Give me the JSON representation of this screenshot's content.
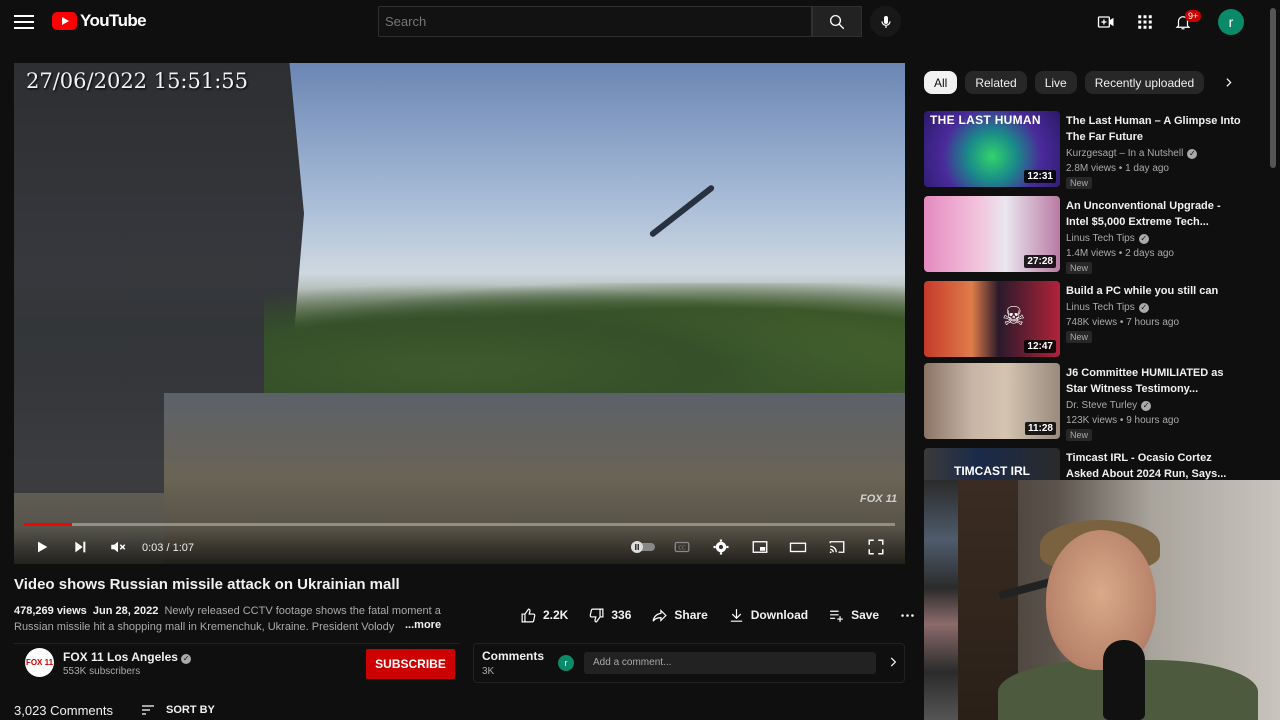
{
  "header": {
    "logo_text": "YouTube",
    "search_placeholder": "Search",
    "notification_badge": "9+",
    "avatar_letter": "r"
  },
  "video": {
    "timestamp_overlay": "27/06/2022 15:51:55",
    "watermark": "FOX 11",
    "current_time": "0:03 / 1:07",
    "progress_fraction": 0.055,
    "title": "Video shows Russian missile attack on Ukrainian mall"
  },
  "description": {
    "views": "478,269 views",
    "date": "Jun 28, 2022",
    "text": "Newly released CCTV footage shows the fatal moment a Russian missile hit a shopping mall in Kremenchuk, Ukraine. President Volody",
    "more_label": "...more"
  },
  "actions": {
    "likes": "2.2K",
    "dislikes": "336",
    "share": "Share",
    "download": "Download",
    "save": "Save"
  },
  "channel": {
    "logo_text": "FOX 11",
    "name": "FOX 11 Los Angeles",
    "subscribers": "553K subscribers",
    "subscribe_label": "SUBSCRIBE"
  },
  "comments_box": {
    "title": "Comments",
    "count": "3K",
    "avatar_letter": "r",
    "placeholder": "Add a comment..."
  },
  "comments_section": {
    "count": "3,023 Comments",
    "sort_label": "SORT BY"
  },
  "chips": [
    "All",
    "Related",
    "Live",
    "Recently uploaded"
  ],
  "recommendations": [
    {
      "title": "The Last Human – A Glimpse Into The Far Future",
      "channel": "Kurzgesagt – In a Nutshell",
      "meta": "2.8M views • 1 day ago",
      "badge": "New",
      "duration": "12:31",
      "thumb_text": "THE LAST HUMAN"
    },
    {
      "title": "An Unconventional Upgrade - Intel $5,000 Extreme Tech...",
      "channel": "Linus Tech Tips",
      "meta": "1.4M views • 2 days ago",
      "badge": "New",
      "duration": "27:28",
      "thumb_text": ""
    },
    {
      "title": "Build a PC while you still can",
      "channel": "Linus Tech Tips",
      "meta": "748K views • 7 hours ago",
      "badge": "New",
      "duration": "12:47",
      "thumb_text": ""
    },
    {
      "title": "J6 Committee HUMILIATED as Star Witness Testimony...",
      "channel": "Dr. Steve Turley",
      "meta": "123K views • 9 hours ago",
      "badge": "New",
      "duration": "11:28",
      "thumb_text": ""
    },
    {
      "title": "Timcast IRL - Ocasio Cortez Asked About 2024 Run, Says...",
      "channel": "",
      "meta": "",
      "badge": "",
      "duration": "",
      "thumb_text": "TIMCAST IRL"
    }
  ],
  "colors": {
    "accent_red": "#ff0000",
    "subscribe_red": "#cc0000",
    "avatar_green": "#0b8a6a",
    "background": "#0f0f0f"
  }
}
